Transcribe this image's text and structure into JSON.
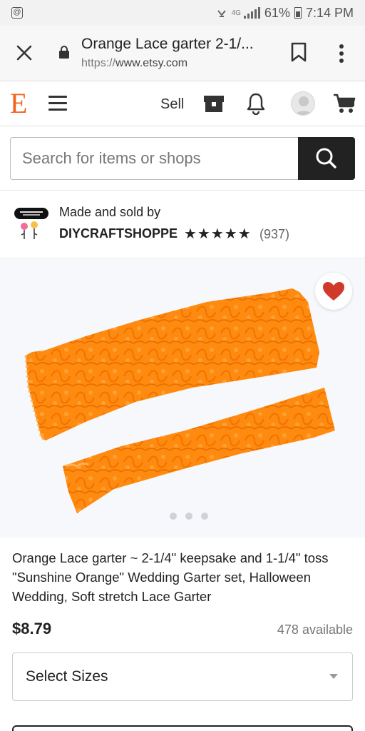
{
  "status_bar": {
    "network": "4G",
    "battery": "61%",
    "time": "7:14 PM"
  },
  "browser": {
    "page_title": "Orange Lace garter 2-1/...",
    "url_scheme": "https://",
    "url_host": "www.etsy.com"
  },
  "header": {
    "logo": "E",
    "sell_label": "Sell"
  },
  "search": {
    "placeholder": "Search for items or shops"
  },
  "shop": {
    "made_by_label": "Made and sold by",
    "name": "DIYCRAFTSHOPPE",
    "stars": "★★★★★",
    "review_count": "(937)"
  },
  "listing": {
    "image_count": 3,
    "active_image": 1,
    "title": "Orange Lace garter ~ 2-1/4\" keepsake and 1-1/4\" toss \"Sunshine Orange\" Wedding Garter set, Halloween Wedding, Soft stretch Lace Garter",
    "price": "$8.79",
    "availability": "478 available",
    "select_sizes_label": "Select Sizes"
  },
  "colors": {
    "etsy_orange": "#f1641e",
    "favorite_red": "#d03a2a",
    "lace_orange": "#ff8a10"
  }
}
